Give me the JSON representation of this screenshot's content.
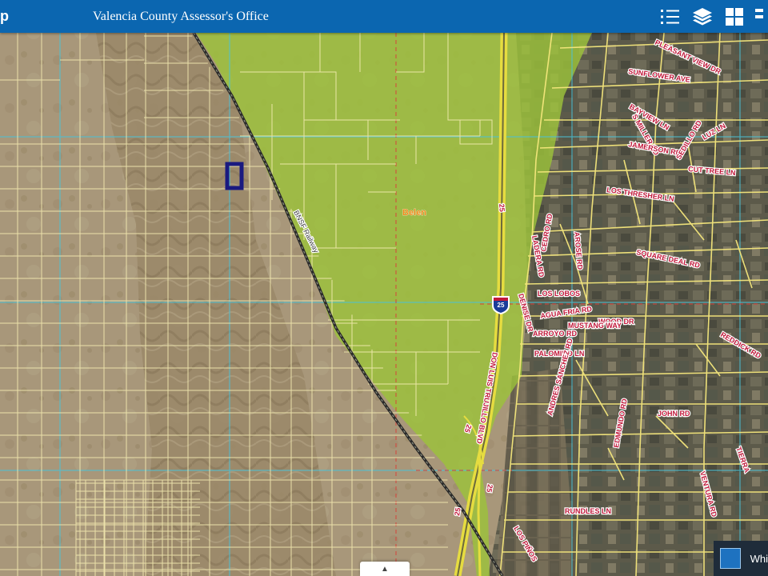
{
  "header": {
    "app_fragment": "p",
    "title": "Valencia County Assessor's Office",
    "tools": [
      {
        "name": "legend-icon"
      },
      {
        "name": "layers-icon"
      },
      {
        "name": "basemap-gallery-icon"
      },
      {
        "name": "overflow-icon"
      }
    ]
  },
  "colors": {
    "header": "#0b66b0",
    "city_limits_fill": "#9cc23a",
    "parcel_lines": "#f3eab0",
    "road_labels": "#c0183a",
    "selected_parcel": "#1a1a80"
  },
  "map": {
    "place_label": "Belen",
    "railway_label": "BNSF Railway",
    "interstate_shield": "25",
    "road_labels": [
      "PLEASANT VIEW DR",
      "SUNFLOWER AVE",
      "S MILLER RD",
      "BAYVIEW LN",
      "LUZ LN",
      "JAMERSON RD",
      "SEDILLO RD",
      "CUT TREE LN",
      "LOS THRESHER LN",
      "25",
      "LADERA RD",
      "AROSE RD",
      "CEDRO RD",
      "SQUARE DEAL RD",
      "LOS LOBOS",
      "DENISE DR",
      "AGUA FRIA RD",
      "ARROYO RD",
      "WOOD DR",
      "MUSTANG WAY",
      "PALOMINO LN",
      "DON LUIS TRUJILLO BLVD",
      "JOHN RD",
      "ANDRES SANCHEZ RD",
      "EDMUNDO RD",
      "RUNDLES LN",
      "LOS PIÑOS",
      "VENTURA RD",
      "TIERRA",
      "REDDICK RD",
      "25",
      "25",
      "25"
    ]
  },
  "footer": {
    "expand_arrow": "▲",
    "basemap_label": "Whi"
  }
}
